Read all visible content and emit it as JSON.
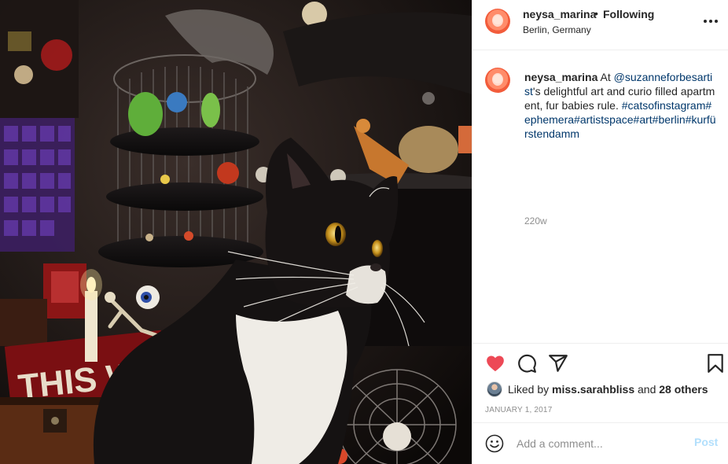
{
  "post": {
    "username": "neysa_marina",
    "separator": "•",
    "follow_status": "Following",
    "location": "Berlin, Germany",
    "more_icon": "more-horizontal-icon"
  },
  "photo": {
    "description_icon": "post-photo",
    "sign_text": "THIS WAY"
  },
  "caption": {
    "username": "neysa_marina",
    "text_part1": " At ",
    "mention": "@suzanneforbesartist",
    "text_part2": "'s delightful art and curio filled apartment, fur babies rule. ",
    "hashtags": [
      "#catsofinstagram",
      "#ephemera",
      "#artistspace",
      "#art",
      "#berlin",
      "#kurfürstendamm"
    ],
    "time_ago": "220w"
  },
  "actions": {
    "heart_icon": "heart-filled-icon",
    "heart_color": "#ed4956",
    "comment_icon": "comment-icon",
    "share_icon": "share-icon",
    "bookmark_icon": "bookmark-icon"
  },
  "likes": {
    "prefix": "Liked by ",
    "first_liker": "miss.sarahbliss",
    "middle": " and ",
    "others": "28 others"
  },
  "date": "JANUARY 1, 2017",
  "comment_box": {
    "placeholder": "Add a comment...",
    "post_label": "Post",
    "post_color": "#b2dffc",
    "emoji_icon": "emoji-icon"
  },
  "colors": {
    "link": "#00376b",
    "muted": "#8e8e8e",
    "text": "#262626",
    "border": "#efefef"
  }
}
